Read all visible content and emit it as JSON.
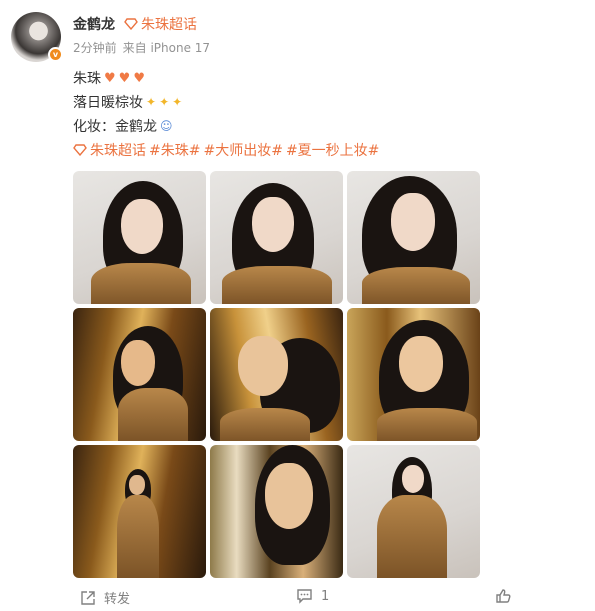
{
  "post": {
    "author": "金鹤龙",
    "supertopic": "朱珠超话",
    "time": "2分钟前",
    "source": "来自 iPhone 17",
    "lines": [
      "朱珠",
      "落日暖棕妆",
      "化妆：金鹤龙"
    ],
    "hashtags": [
      "朱珠超话",
      "#朱珠#",
      "#大师出妆#",
      "#夏一秒上妆#"
    ]
  },
  "actions": {
    "repost_label": "转发",
    "comment_count": "1"
  },
  "icons": [
    "supertopic-diamond-icon",
    "verified-badge-icon",
    "heart-emoji",
    "sparkles-emoji",
    "woman-emoji",
    "repost-icon",
    "comment-icon",
    "like-icon"
  ],
  "colors": {
    "accent": "#eb7340",
    "meta": "#939393",
    "text": "#333333",
    "badge": "#f08c1e"
  },
  "photos": [
    {
      "tone": "light"
    },
    {
      "tone": "light"
    },
    {
      "tone": "light"
    },
    {
      "tone": "gold"
    },
    {
      "tone": "gold"
    },
    {
      "tone": "gold"
    },
    {
      "tone": "gold"
    },
    {
      "tone": "blur"
    },
    {
      "tone": "light"
    }
  ]
}
